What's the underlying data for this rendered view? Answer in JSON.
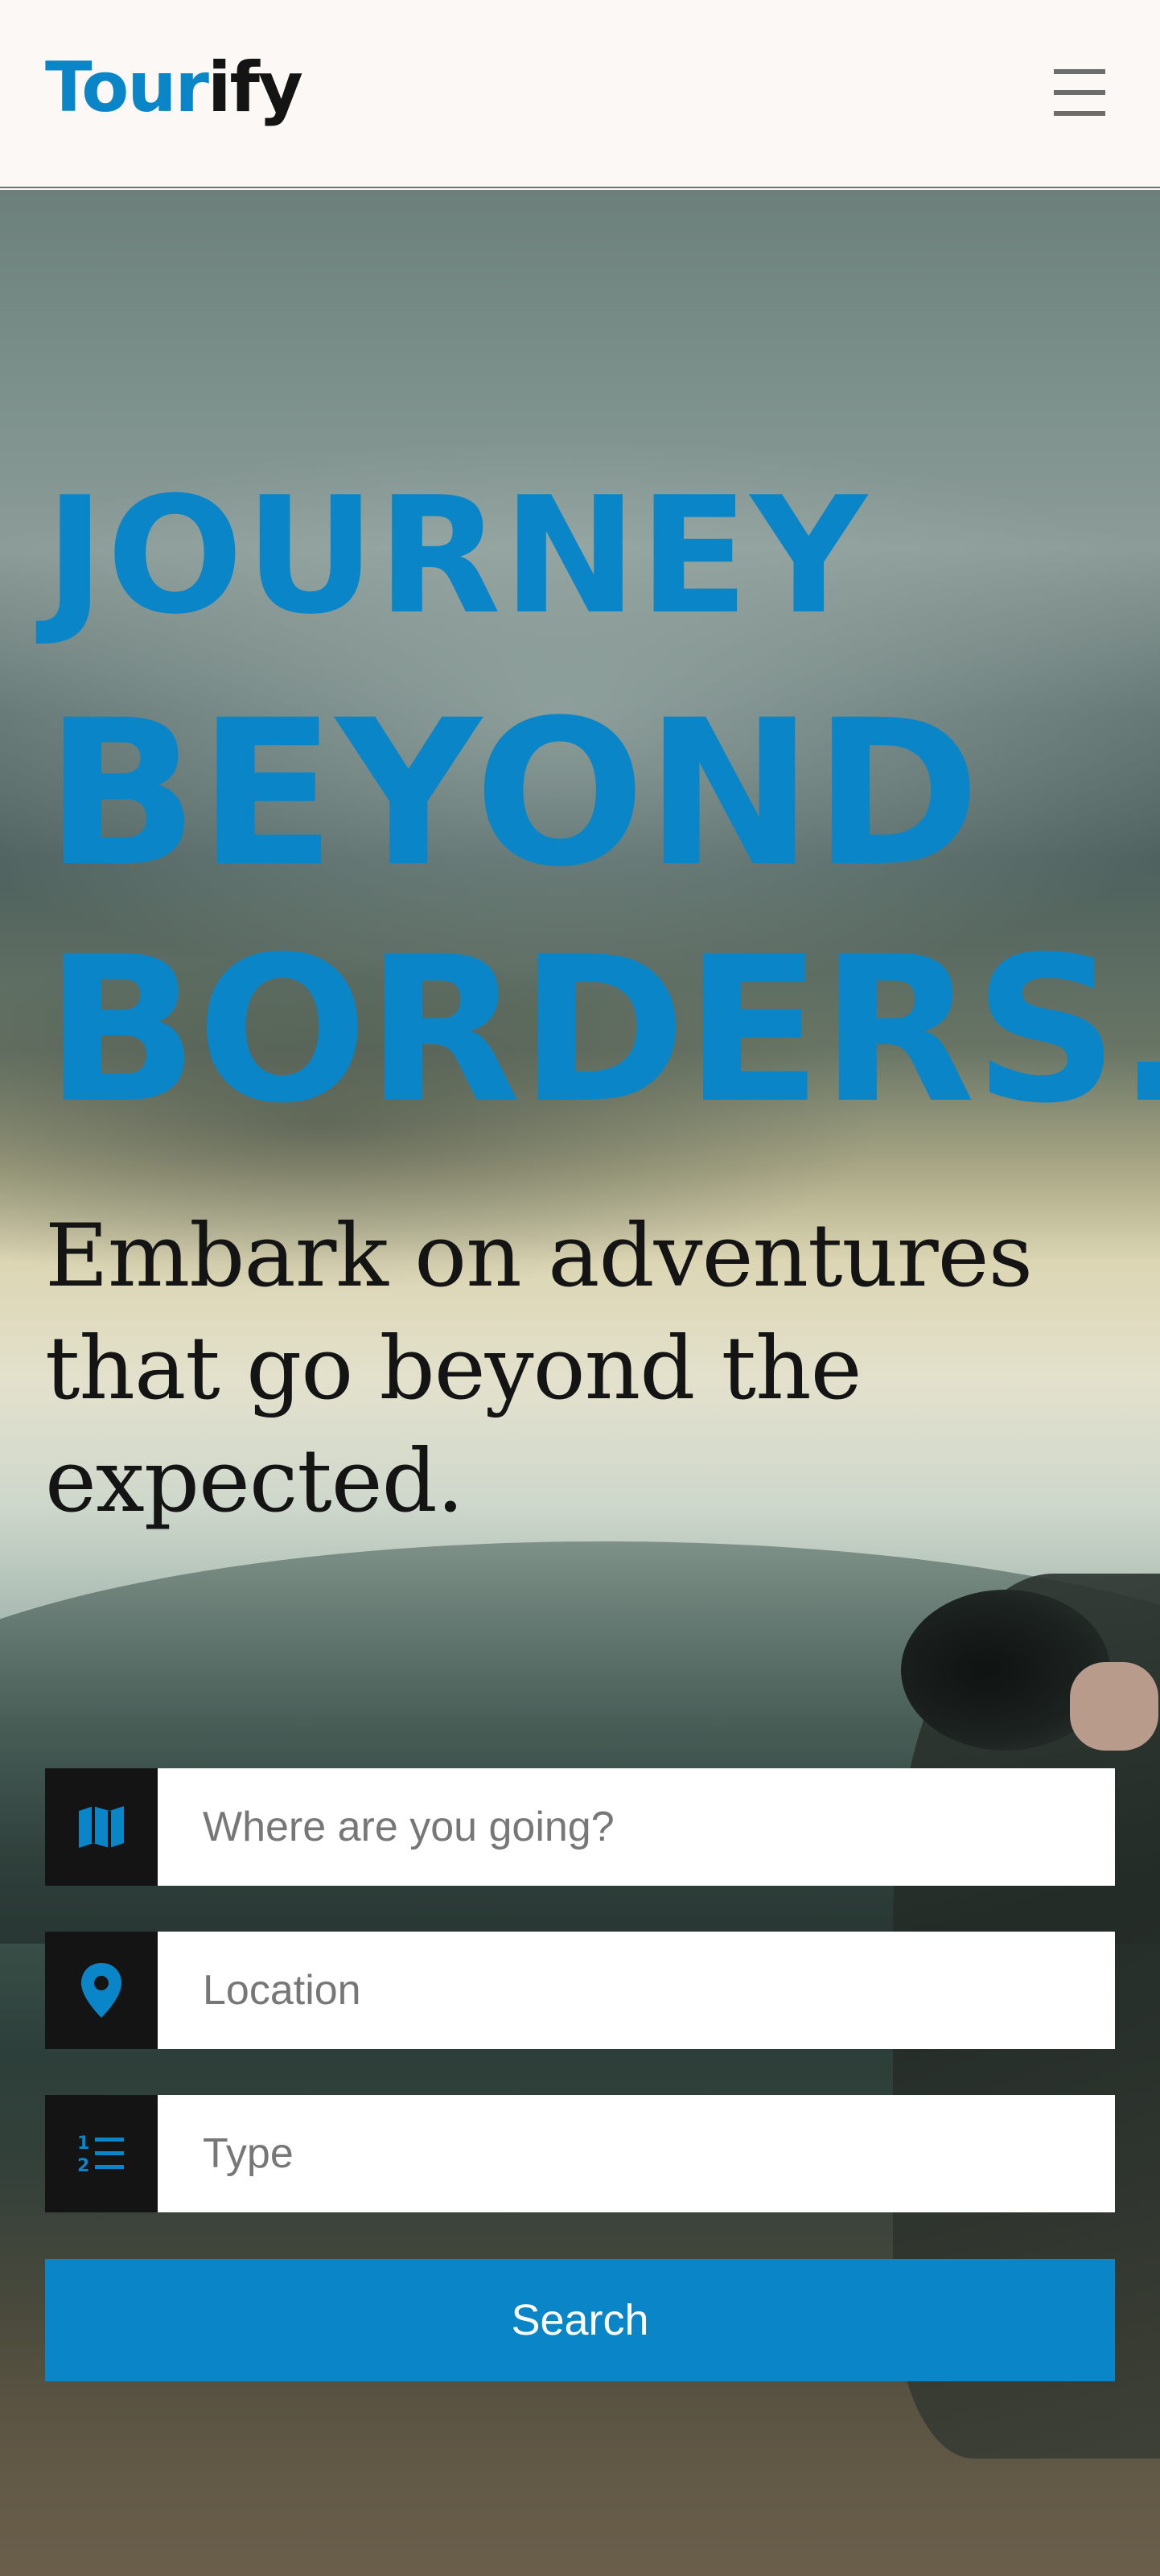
{
  "header": {
    "logo_part1": "Tour",
    "logo_part2": "ify",
    "menu_icon": "hamburger-menu-icon"
  },
  "hero": {
    "headline_line1": "JOURNEY",
    "headline_line2": "BEYOND",
    "headline_line3": "BORDERS.",
    "subheading": "Embark on adventures that go beyond the expected."
  },
  "search_form": {
    "destination": {
      "icon": "map-icon",
      "placeholder": "Where are you going?",
      "value": ""
    },
    "location": {
      "icon": "location-pin-icon",
      "placeholder": "Location",
      "value": ""
    },
    "type": {
      "icon": "numbered-list-icon",
      "placeholder": "Type",
      "value": ""
    },
    "submit_label": "Search"
  },
  "colors": {
    "accent": "#0a86c8",
    "dark": "#141414",
    "header_bg": "#fbf8f5"
  }
}
